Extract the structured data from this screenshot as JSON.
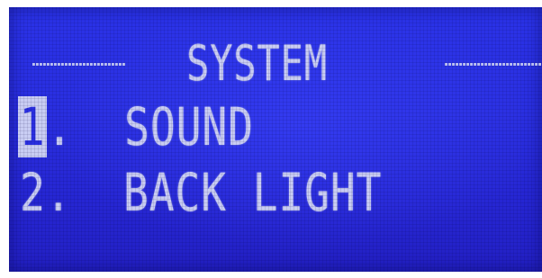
{
  "screen": {
    "header": {
      "left_decoration": "----",
      "title": "SYSTEM",
      "right_decoration": "----"
    },
    "menu": {
      "items": [
        {
          "number": "1",
          "separator": ".",
          "label": "SOUND",
          "selected": true
        },
        {
          "number": "2",
          "separator": ".",
          "label": "BACK LIGHT",
          "selected": false
        }
      ]
    }
  },
  "colors": {
    "background": "#2a2fe0",
    "text": "#c9cdf3",
    "frame": "#ffffff"
  }
}
